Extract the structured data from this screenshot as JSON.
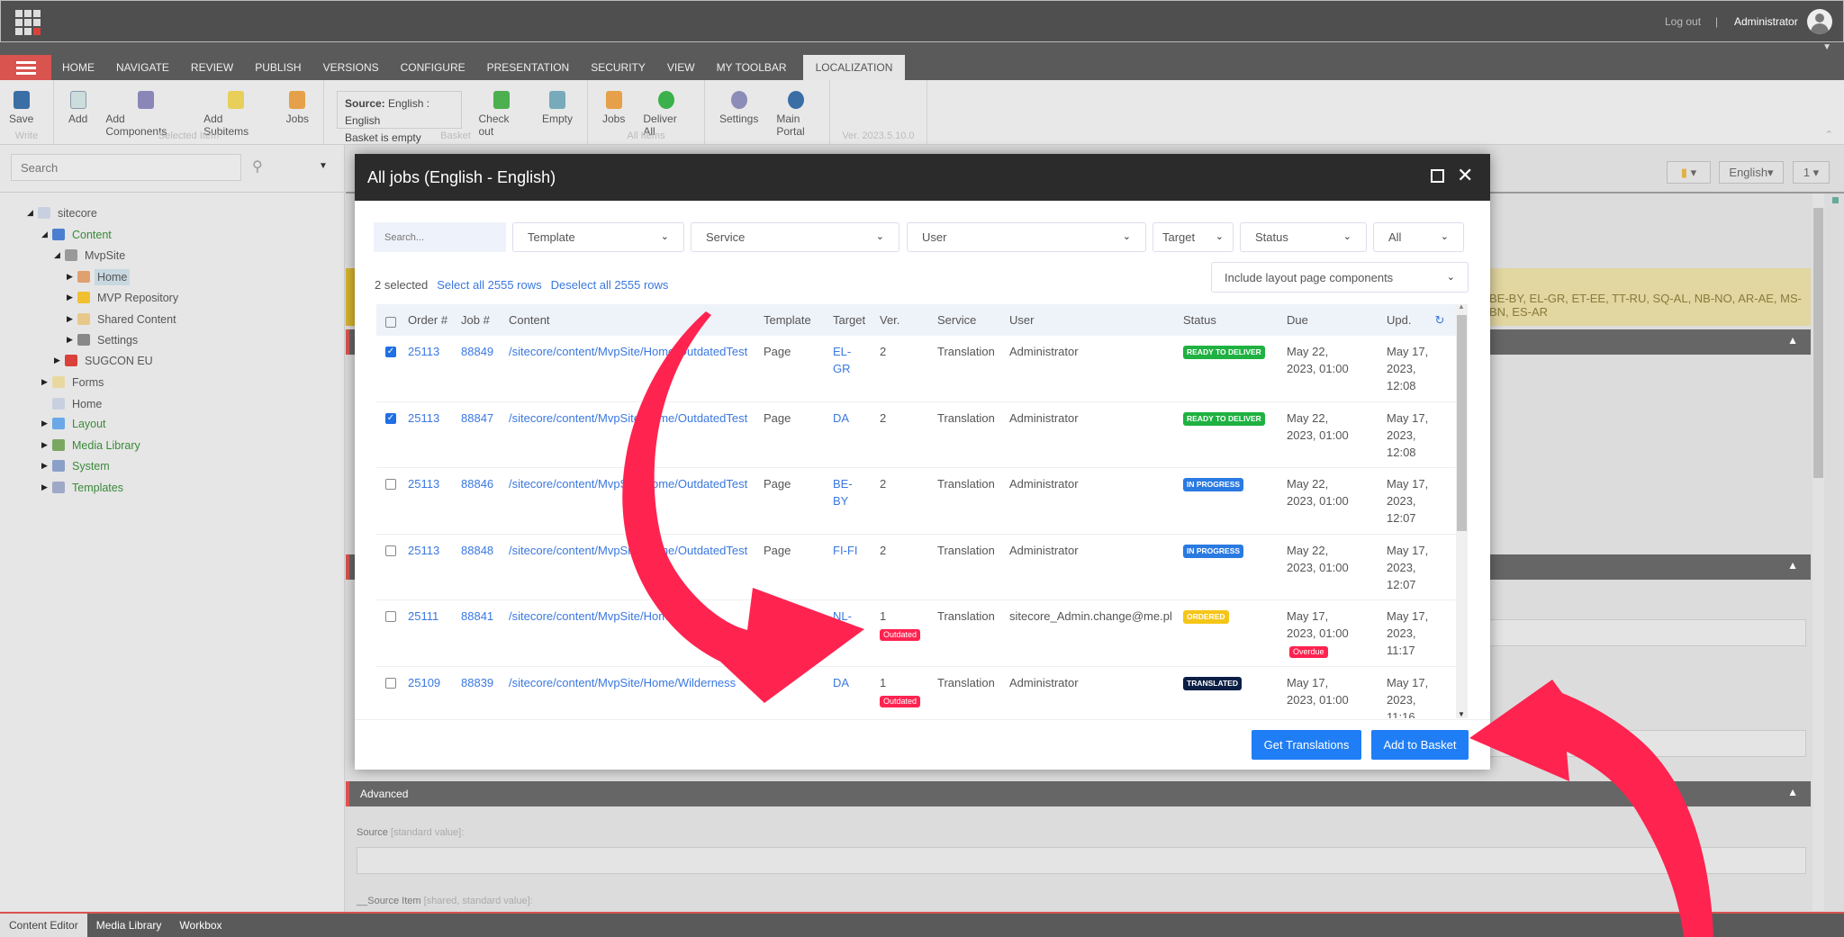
{
  "topbar": {
    "logout": "Log out",
    "separator": "|",
    "user": "Administrator"
  },
  "tabs": [
    "HOME",
    "NAVIGATE",
    "REVIEW",
    "PUBLISH",
    "VERSIONS",
    "CONFIGURE",
    "PRESENTATION",
    "SECURITY",
    "VIEW",
    "MY TOOLBAR",
    "LOCALIZATION"
  ],
  "active_tab": "LOCALIZATION",
  "ribbon": {
    "write": {
      "label": "Write",
      "save": "Save"
    },
    "selected": {
      "label": "Selected Item",
      "add": "Add",
      "add_components": "Add Components",
      "add_subitems": "Add Subitems",
      "jobs": "Jobs"
    },
    "basket": {
      "label": "Basket",
      "source_label": "Source:",
      "source_value": "English : English",
      "status": "Basket is empty",
      "check_out": "Check out",
      "empty": "Empty"
    },
    "all_items": {
      "label": "All Items",
      "jobs": "Jobs",
      "deliver_all": "Deliver All"
    },
    "other": {
      "settings": "Settings",
      "main_portal": "Main Portal"
    },
    "version": "Ver. 2023.5.10.0"
  },
  "left": {
    "search_placeholder": "Search",
    "tree": [
      "sitecore",
      "Content",
      "MvpSite",
      "Home",
      "MVP Repository",
      "Shared Content",
      "Settings",
      "SUGCON EU",
      "Forms",
      "Home",
      "Layout",
      "Media Library",
      "System",
      "Templates"
    ]
  },
  "right": {
    "language": "English",
    "version": "1",
    "banner": "BE-BY, EL-GR, ET-EE, TT-RU, SQ-AL, NB-NO, AR-AE, MS-BN, ES-AR",
    "advanced": "Advanced",
    "source_label": "Source",
    "source_hint": "[standard value]:",
    "source_item_label": "__Source Item",
    "source_item_hint": "[shared, standard value]:"
  },
  "bottom_tabs": [
    "Content Editor",
    "Media Library",
    "Workbox"
  ],
  "dialog": {
    "title": "All jobs (English - English)",
    "search_placeholder": "Search...",
    "filters": {
      "template": "Template",
      "service": "Service",
      "user": "User",
      "target": "Target",
      "status": "Status",
      "all": "All"
    },
    "selected": "2 selected",
    "select_all": "Select all 2555 rows",
    "deselect_all": "Deselect all 2555 rows",
    "include": "Include layout page components",
    "columns": [
      "Order #",
      "Job #",
      "Content",
      "Template",
      "Target",
      "Ver.",
      "Service",
      "User",
      "Status",
      "Due",
      "Upd."
    ],
    "rows": [
      {
        "checked": true,
        "order": "25113",
        "job": "88849",
        "content": "/sitecore/content/MvpSite/Home/OutdatedTest",
        "template": "Page",
        "target": "EL-GR",
        "ver": "2",
        "outdated": "",
        "service": "Translation",
        "user": "Administrator",
        "status": "READY TO DELIVER",
        "status_color": "#1fb141",
        "due": "May 22, 2023, 01:00",
        "overdue": "",
        "upd": "May 17, 2023, 12:08"
      },
      {
        "checked": true,
        "order": "25113",
        "job": "88847",
        "content": "/sitecore/content/MvpSite/Home/OutdatedTest",
        "template": "Page",
        "target": "DA",
        "ver": "2",
        "outdated": "",
        "service": "Translation",
        "user": "Administrator",
        "status": "READY TO DELIVER",
        "status_color": "#1fb141",
        "due": "May 22, 2023, 01:00",
        "overdue": "",
        "upd": "May 17, 2023, 12:08"
      },
      {
        "checked": false,
        "order": "25113",
        "job": "88846",
        "content": "/sitecore/content/MvpSite/Home/OutdatedTest",
        "template": "Page",
        "target": "BE-BY",
        "ver": "2",
        "outdated": "",
        "service": "Translation",
        "user": "Administrator",
        "status": "IN PROGRESS",
        "status_color": "#2a7ae2",
        "due": "May 22, 2023, 01:00",
        "overdue": "",
        "upd": "May 17, 2023, 12:07"
      },
      {
        "checked": false,
        "order": "25113",
        "job": "88848",
        "content": "/sitecore/content/MvpSite/Home/OutdatedTest",
        "template": "Page",
        "target": "FI-FI",
        "ver": "2",
        "outdated": "",
        "service": "Translation",
        "user": "Administrator",
        "status": "IN PROGRESS",
        "status_color": "#2a7ae2",
        "due": "May 22, 2023, 01:00",
        "overdue": "",
        "upd": "May 17, 2023, 12:07"
      },
      {
        "checked": false,
        "order": "25111",
        "job": "88841",
        "content": "/sitecore/content/MvpSite/Home",
        "template": "",
        "target": "NL-",
        "ver": "1",
        "outdated": "Outdated",
        "service": "Translation",
        "user": "sitecore_Admin.change@me.pl",
        "status": "ORDERED",
        "status_color": "#f5c518",
        "due": "May 17, 2023, 01:00",
        "overdue": "Overdue",
        "upd": "May 17, 2023, 11:17"
      },
      {
        "checked": false,
        "order": "25109",
        "job": "88839",
        "content": "/sitecore/content/MvpSite/Home/Wilderness",
        "template": "",
        "target": "DA",
        "ver": "1",
        "outdated": "Outdated",
        "service": "Translation",
        "user": "Administrator",
        "status": "TRANSLATED",
        "status_color": "#0b1f45",
        "due": "May 17, 2023, 01:00",
        "overdue": "",
        "upd": "May 17, 2023, 11:16"
      }
    ],
    "get_translations": "Get Translations",
    "add_to_basket": "Add to Basket"
  },
  "colors": {
    "accent": "#1f7ef5",
    "annotation_arrow": "#ff2350",
    "brand_red": "#d9534f"
  }
}
